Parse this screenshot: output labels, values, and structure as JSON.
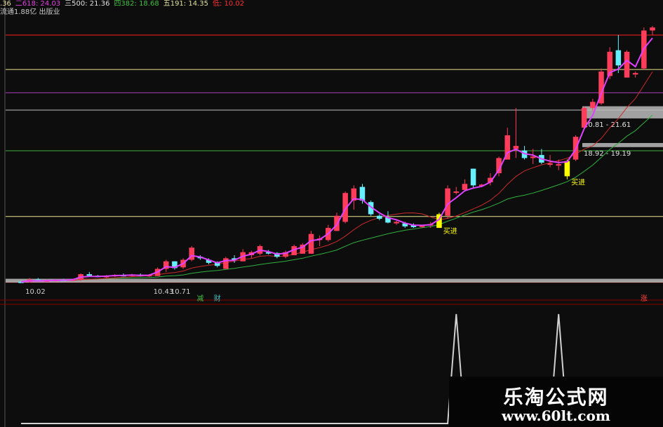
{
  "legend": [
    {
      "text": ".36",
      "color": "#e8e0a0"
    },
    {
      "text": "二618: 24.03",
      "color": "#e040e0"
    },
    {
      "text": "三500: 21.36",
      "color": "#e0e0e0"
    },
    {
      "text": "四382: 18.68",
      "color": "#40c040"
    },
    {
      "text": "五191: 14.35",
      "color": "#e0e0a0"
    },
    {
      "text": "低: 10.02",
      "color": "#ff3030"
    }
  ],
  "info": "流通1.88亿 出版业",
  "colors": {
    "up": "#ff3c5a",
    "down": "#66f0ff",
    "signal": "#ffff00",
    "ma_fast": "#e040ff",
    "ma_mid": "#cc2a2a",
    "ma_slow": "#30b040",
    "level_yellow": "#e8e88c",
    "level_purple": "#b040c0",
    "level_white": "#c0c0c0",
    "level_green": "#40b040",
    "level_red": "#ff2020",
    "zone_gray": "#bcbcbc",
    "oscillator": "#d0d0d0"
  },
  "chart_data": [
    {
      "type": "candlestick",
      "price_range": [
        9.4,
        27.5
      ],
      "levels": [
        {
          "value": 26.3,
          "style": "red"
        },
        {
          "value": 24.03,
          "style": "yellow"
        },
        {
          "value": 22.5,
          "style": "purple"
        },
        {
          "value": 21.36,
          "style": "white"
        },
        {
          "value": 18.68,
          "style": "green"
        },
        {
          "value": 14.35,
          "style": "yellow"
        },
        {
          "value": 10.02,
          "style": "red"
        }
      ],
      "zones": [
        {
          "low": 20.81,
          "high": 21.61,
          "label": "20.81 - 21.61"
        },
        {
          "low": 18.92,
          "high": 19.19,
          "label": "18.92 - 19.19"
        },
        {
          "low": 10.0,
          "high": 10.25,
          "label": ""
        }
      ],
      "candles": [
        [
          10.06,
          10.12,
          9.98,
          10.04
        ],
        [
          10.04,
          10.3,
          10.0,
          10.2
        ],
        [
          10.2,
          10.3,
          10.1,
          10.1
        ],
        [
          10.12,
          10.2,
          10.06,
          10.14
        ],
        [
          10.14,
          10.22,
          10.1,
          10.18
        ],
        [
          10.18,
          10.25,
          10.12,
          10.16
        ],
        [
          10.16,
          10.22,
          10.1,
          10.2
        ],
        [
          10.2,
          10.6,
          10.1,
          10.55
        ],
        [
          10.55,
          10.7,
          10.4,
          10.45
        ],
        [
          10.45,
          10.5,
          10.35,
          10.4
        ],
        [
          10.4,
          10.5,
          10.3,
          10.44
        ],
        [
          10.44,
          10.56,
          10.36,
          10.5
        ],
        [
          10.5,
          10.6,
          10.4,
          10.48
        ],
        [
          10.48,
          10.58,
          10.4,
          10.52
        ],
        [
          10.52,
          10.6,
          10.4,
          10.45
        ],
        [
          10.45,
          10.55,
          10.38,
          10.5
        ],
        [
          10.43,
          11.0,
          10.43,
          10.9
        ],
        [
          10.9,
          11.5,
          10.7,
          11.4
        ],
        [
          11.4,
          11.4,
          10.85,
          10.95
        ],
        [
          11.0,
          11.6,
          10.9,
          11.5
        ],
        [
          11.5,
          12.4,
          11.4,
          12.3
        ],
        [
          11.7,
          11.8,
          11.5,
          11.6
        ],
        [
          11.5,
          11.6,
          11.2,
          11.3
        ],
        [
          11.35,
          11.4,
          11.0,
          11.1
        ],
        [
          10.9,
          11.7,
          10.9,
          11.6
        ],
        [
          11.6,
          11.8,
          11.3,
          11.5
        ],
        [
          11.4,
          12.2,
          11.4,
          12.0
        ],
        [
          11.8,
          12.1,
          11.6,
          12.0
        ],
        [
          11.9,
          12.5,
          11.8,
          12.4
        ],
        [
          12.0,
          12.15,
          11.85,
          11.95
        ],
        [
          11.95,
          12.0,
          11.6,
          11.7
        ],
        [
          11.7,
          12.1,
          11.6,
          12.0
        ],
        [
          11.8,
          12.5,
          11.8,
          12.4
        ],
        [
          11.9,
          12.6,
          11.9,
          12.5
        ],
        [
          11.9,
          13.4,
          11.9,
          13.2
        ],
        [
          12.8,
          13.1,
          12.4,
          12.9
        ],
        [
          12.8,
          13.8,
          12.7,
          13.6
        ],
        [
          13.4,
          14.6,
          13.4,
          14.4
        ],
        [
          14.0,
          16.0,
          13.9,
          15.9
        ],
        [
          15.4,
          16.4,
          14.8,
          16.2
        ],
        [
          16.3,
          16.5,
          15.2,
          15.4
        ],
        [
          15.3,
          15.4,
          14.4,
          14.5
        ],
        [
          14.4,
          14.5,
          14.1,
          14.2
        ],
        [
          14.3,
          14.7,
          13.9,
          13.95
        ],
        [
          13.9,
          14.1,
          13.8,
          14.0
        ],
        [
          13.9,
          14.0,
          13.6,
          13.7
        ],
        [
          13.8,
          13.9,
          13.6,
          13.65
        ],
        [
          13.7,
          13.8,
          13.6,
          13.75
        ],
        [
          13.8,
          14.0,
          13.6,
          13.85
        ],
        [
          13.6,
          14.6,
          13.6,
          14.5
        ],
        [
          14.4,
          16.4,
          14.2,
          16.2
        ],
        [
          16.0,
          16.3,
          15.8,
          16.0
        ],
        [
          16.1,
          16.8,
          16.0,
          16.5
        ],
        [
          17.5,
          17.5,
          16.2,
          16.4
        ],
        [
          16.4,
          16.5,
          16.3,
          16.45
        ],
        [
          16.6,
          17.2,
          16.4,
          16.9
        ],
        [
          17.2,
          18.3,
          17.0,
          18.2
        ],
        [
          18.1,
          20.2,
          18.1,
          19.7
        ],
        [
          18.8,
          21.5,
          18.2,
          19.0
        ],
        [
          18.7,
          19.0,
          18.1,
          18.2
        ],
        [
          18.2,
          18.8,
          17.8,
          18.3
        ],
        [
          18.4,
          18.8,
          17.8,
          17.9
        ],
        [
          17.8,
          18.4,
          17.6,
          17.85
        ],
        [
          17.7,
          18.1,
          17.4,
          17.8
        ],
        [
          17.0,
          18.1,
          16.8,
          18.0
        ],
        [
          18.1,
          19.7,
          18.0,
          19.6
        ],
        [
          20.2,
          21.6,
          20.1,
          21.5
        ],
        [
          21.5,
          22.1,
          21.3,
          21.9
        ],
        [
          21.8,
          24.1,
          21.7,
          23.9
        ],
        [
          23.6,
          25.5,
          23.4,
          25.2
        ],
        [
          25.3,
          26.3,
          23.8,
          24.3
        ],
        [
          23.5,
          25.3,
          23.5,
          25.2
        ],
        [
          23.7,
          23.9,
          23.5,
          23.8
        ],
        [
          24.1,
          26.8,
          24.0,
          26.6
        ],
        [
          26.6,
          26.9,
          26.3,
          26.8
        ]
      ],
      "signal_candles": [
        49,
        64
      ],
      "annotations": [
        {
          "text": "买进",
          "candle": 49
        },
        {
          "text": "买进",
          "candle": 64
        },
        {
          "text": "10.02",
          "candle": 1
        },
        {
          "text": "10.43",
          "candle": 16
        },
        {
          "text": "10.71",
          "candle": 18
        }
      ],
      "ma_fast_offsets": [
        0,
        0.03,
        0.01
      ],
      "ma_mid_period": 10,
      "ma_slow_period": 20
    },
    {
      "type": "line",
      "values": [
        0,
        0,
        0,
        0,
        0,
        0,
        0,
        0,
        0,
        0,
        0,
        0,
        0,
        0,
        0,
        0,
        0,
        0,
        0,
        0,
        0,
        0,
        0,
        0,
        0,
        0,
        0,
        0,
        0,
        0,
        0,
        0,
        0,
        0,
        0,
        0,
        0,
        0,
        0,
        0,
        0,
        0,
        0,
        0,
        0,
        0,
        0,
        0,
        0,
        0,
        0,
        0,
        0,
        0,
        0,
        0,
        0,
        0,
        0,
        0,
        0,
        0,
        0,
        0,
        0,
        0,
        0,
        0,
        0,
        0,
        0,
        0,
        0,
        0,
        0
      ],
      "peaks": [
        {
          "candle": 51,
          "value": 100
        },
        {
          "candle": 63,
          "value": 100
        }
      ],
      "range": [
        0,
        100
      ],
      "markers": [
        {
          "text": "减",
          "candle": 21,
          "color": "#40c040"
        },
        {
          "text": "财",
          "candle": 23,
          "color": "#40c0c0"
        },
        {
          "text": "涨",
          "candle": 73,
          "color": "#ff4040"
        }
      ]
    }
  ],
  "watermark": {
    "title": "乐淘公式网",
    "url": "www.60lt.com"
  }
}
